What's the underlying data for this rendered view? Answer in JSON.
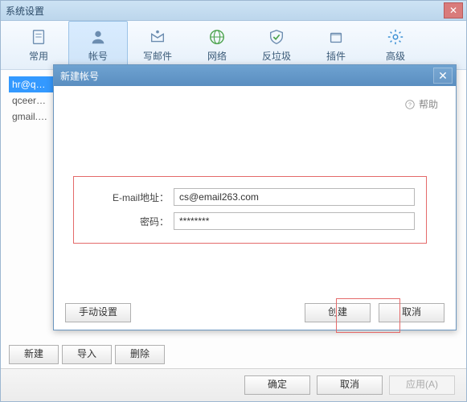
{
  "main": {
    "title": "系统设置",
    "footer": {
      "ok": "确定",
      "cancel": "取消",
      "apply": "应用(A)"
    }
  },
  "toolbar": {
    "items": [
      {
        "label": "常用"
      },
      {
        "label": "帐号"
      },
      {
        "label": "写邮件"
      },
      {
        "label": "网络"
      },
      {
        "label": "反垃圾"
      },
      {
        "label": "插件"
      },
      {
        "label": "高级"
      }
    ]
  },
  "accounts": {
    "items": [
      {
        "label": "hr@q…"
      },
      {
        "label": "qceer…"
      },
      {
        "label": "gmail.…"
      }
    ],
    "buttons": {
      "new": "新建",
      "import": "导入",
      "delete": "删除"
    }
  },
  "modal": {
    "title": "新建帐号",
    "help": "帮助",
    "form": {
      "email_label": "E-mail地址：",
      "email_value": "cs@email263.com",
      "password_label": "密码：",
      "password_value": "********"
    },
    "footer": {
      "manual": "手动设置",
      "create": "创建",
      "cancel": "取消"
    }
  }
}
